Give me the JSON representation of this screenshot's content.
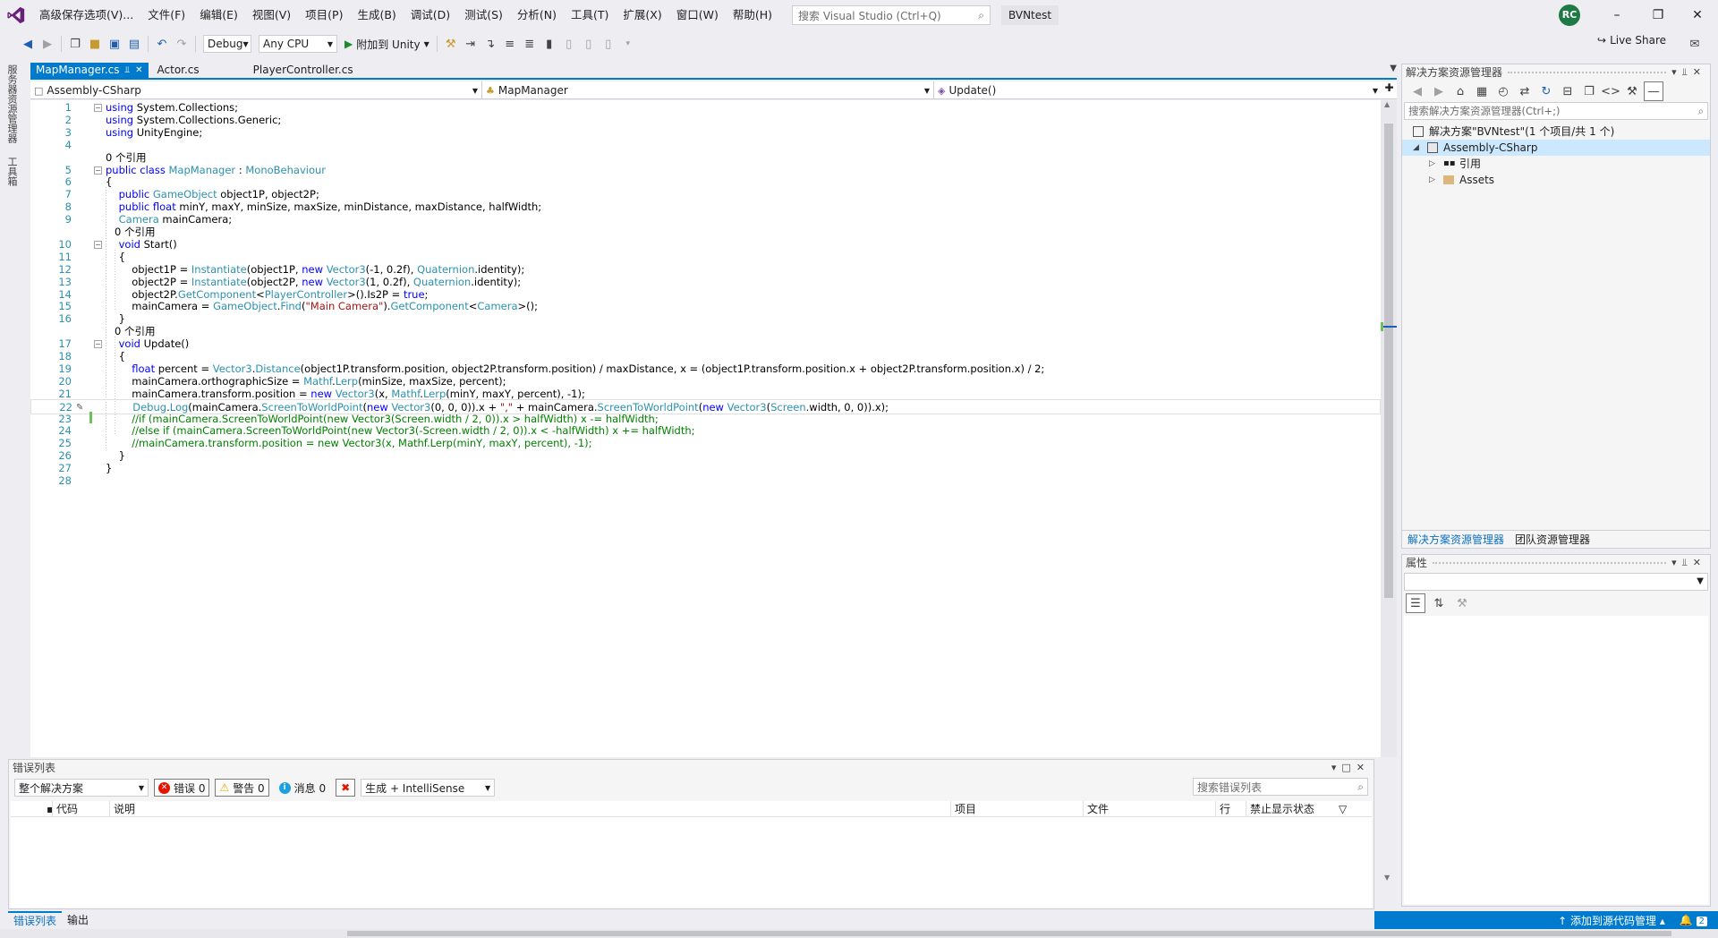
{
  "app": {
    "menu": [
      "高级保存选项(V)...",
      "文件(F)",
      "编辑(E)",
      "视图(V)",
      "项目(P)",
      "生成(B)",
      "调试(D)",
      "测试(S)",
      "分析(N)",
      "工具(T)",
      "扩展(X)",
      "窗口(W)",
      "帮助(H)"
    ],
    "search_placeholder": "搜索 Visual Studio (Ctrl+Q)",
    "solution_name": "BVNtest",
    "user_initials": "RC",
    "accent_color": "#007acc"
  },
  "toolbar": {
    "config": "Debug",
    "platform": "Any CPU",
    "attach_label": "附加到 Unity",
    "live_share_label": "Live Share"
  },
  "left_strip": {
    "tabs": [
      "服务器资源管理器",
      "工具箱"
    ]
  },
  "tabs": [
    {
      "label": "MapManager.cs",
      "active": true
    },
    {
      "label": "Actor.cs",
      "active": false
    },
    {
      "label": "PlayerController.cs",
      "active": false
    }
  ],
  "nav": {
    "project": "Assembly-CSharp",
    "class": "MapManager",
    "member": "Update()"
  },
  "code": {
    "lines": [
      {
        "n": "1",
        "text": "using System.Collections;"
      },
      {
        "n": "2",
        "text": "using System.Collections.Generic;"
      },
      {
        "n": "3",
        "text": "using UnityEngine;"
      },
      {
        "n": "4",
        "text": ""
      },
      {
        "lens": "0 个引用"
      },
      {
        "n": "5",
        "text": "public class MapManager : MonoBehaviour"
      },
      {
        "n": "6",
        "text": "{"
      },
      {
        "n": "7",
        "text": "    public GameObject object1P, object2P;"
      },
      {
        "n": "8",
        "text": "    public float minY, maxY, minSize, maxSize, minDistance, maxDistance, halfWidth;"
      },
      {
        "n": "9",
        "text": "    Camera mainCamera;"
      },
      {
        "lens": "0 个引用"
      },
      {
        "n": "10",
        "text": "    void Start()"
      },
      {
        "n": "11",
        "text": "    {"
      },
      {
        "n": "12",
        "text": "        object1P = Instantiate(object1P, new Vector3(-1, 0.2f), Quaternion.identity);"
      },
      {
        "n": "13",
        "text": "        object2P = Instantiate(object2P, new Vector3(1, 0.2f), Quaternion.identity);"
      },
      {
        "n": "14",
        "text": "        object2P.GetComponent<PlayerController>().Is2P = true;"
      },
      {
        "n": "15",
        "text": "        mainCamera = GameObject.Find(\"Main Camera\").GetComponent<Camera>();"
      },
      {
        "n": "16",
        "text": "    }"
      },
      {
        "lens": "0 个引用"
      },
      {
        "n": "17",
        "text": "    void Update()"
      },
      {
        "n": "18",
        "text": "    {"
      },
      {
        "n": "19",
        "text": "        float percent = Vector3.Distance(object1P.transform.position, object2P.transform.position) / maxDistance, x = (object1P.transform.position.x + object2P.transform.position.x) / 2;"
      },
      {
        "n": "20",
        "text": "        mainCamera.orthographicSize = Mathf.Lerp(minSize, maxSize, percent);"
      },
      {
        "n": "21",
        "text": "        mainCamera.transform.position = new Vector3(x, Mathf.Lerp(minY, maxY, percent), -1);"
      },
      {
        "n": "22",
        "text": "        Debug.Log(mainCamera.ScreenToWorldPoint(new Vector3(0, 0, 0)).x + \",\" + mainCamera.ScreenToWorldPoint(new Vector3(Screen.width, 0, 0)).x);"
      },
      {
        "n": "23",
        "text": "        //if (mainCamera.ScreenToWorldPoint(new Vector3(Screen.width / 2, 0)).x > halfWidth) x -= halfWidth;"
      },
      {
        "n": "24",
        "text": "        //else if (mainCamera.ScreenToWorldPoint(new Vector3(-Screen.width / 2, 0)).x < -halfWidth) x += halfWidth;"
      },
      {
        "n": "25",
        "text": "        //mainCamera.transform.position = new Vector3(x, Mathf.Lerp(minY, maxY, percent), -1);"
      },
      {
        "n": "26",
        "text": "    }"
      },
      {
        "n": "27",
        "text": "}"
      },
      {
        "n": "28",
        "text": ""
      }
    ]
  },
  "error_list": {
    "title": "错误列表",
    "scope": "整个解决方案",
    "errors_label": "错误 0",
    "warnings_label": "警告 0",
    "messages_label": "消息 0",
    "build_filter": "生成 + IntelliSense",
    "search_placeholder": "搜索错误列表",
    "columns": [
      "代码",
      "说明",
      "项目",
      "文件",
      "行",
      "禁止显示状态"
    ]
  },
  "bottom_tabs": [
    "错误列表",
    "输出"
  ],
  "solution_explorer": {
    "title": "解决方案资源管理器",
    "search_placeholder": "搜索解决方案资源管理器(Ctrl+;)",
    "tree": [
      {
        "label": "解决方案\"BVNtest\"(1 个项目/共 1 个)",
        "level": 0,
        "expandable": false
      },
      {
        "label": "Assembly-CSharp",
        "level": 1,
        "expandable": true,
        "expanded": true,
        "selected": true
      },
      {
        "label": "引用",
        "level": 2,
        "expandable": true
      },
      {
        "label": "Assets",
        "level": 2,
        "expandable": true
      }
    ],
    "tabs": [
      "解决方案资源管理器",
      "团队资源管理器"
    ]
  },
  "properties": {
    "title": "属性"
  },
  "status_bar": {
    "source_control": "添加到源代码管理",
    "notifications": "2"
  }
}
